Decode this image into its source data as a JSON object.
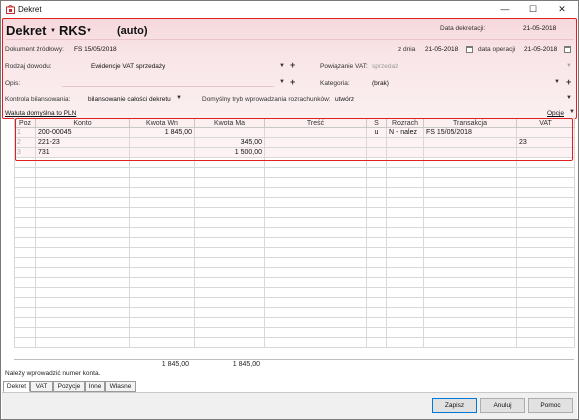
{
  "window": {
    "title": "Dekret",
    "minimize": "—",
    "maximize": "☐",
    "close": "✕"
  },
  "header": {
    "doc_type": "Dekret",
    "register": "RKS",
    "number": "(auto)",
    "date_label": "Data dekretacji:",
    "date_value": "21-05-2018",
    "source_doc_label": "Dokument źródłowy:",
    "source_doc_value": "FS 15/05/2018",
    "z_dnia_label": "z dnia",
    "z_dnia_value": "21-05-2018",
    "operation_date_label": "data operacji",
    "operation_date_value": "21-05-2018",
    "proof_type_label": "Rodzaj dowodu:",
    "proof_type_value": "Ewidencje VAT sprzedaży",
    "vat_link_label": "Powiązanie VAT:",
    "vat_link_value": "sprzedaż",
    "description_label": "Opis:",
    "category_label": "Kategoria:",
    "category_value": "(brak)",
    "balance_control_label": "Kontrola bilansowania:",
    "balance_control_value": "bilansowanie całości dekretu",
    "default_mode_label": "Domyślny tryb wprowadzania rozrachunków:",
    "default_mode_value": "utwórz",
    "currency_link": "Waluta domyślna to PLN",
    "options_label": "Opcje"
  },
  "grid": {
    "columns": [
      "Poz",
      "Konto",
      "Kwota Wn",
      "Kwota Ma",
      "Treść",
      "S",
      "Rozrach",
      "Transakcja",
      "VAT"
    ],
    "rows": [
      {
        "poz": "1",
        "konto": "200-00045",
        "wn": "1 845,00",
        "ma": "",
        "tresc": "",
        "s": "u",
        "rozrach": "N - nalez",
        "transakcja": "FS 15/05/2018",
        "vat": ""
      },
      {
        "poz": "2",
        "konto": "221-23",
        "wn": "",
        "ma": "345,00",
        "tresc": "",
        "s": "",
        "rozrach": "",
        "transakcja": "",
        "vat": "23"
      },
      {
        "poz": "3",
        "konto": "731",
        "wn": "",
        "ma": "1 500,00",
        "tresc": "",
        "s": "",
        "rozrach": "",
        "transakcja": "",
        "vat": ""
      }
    ],
    "total_wn": "1 845,00",
    "total_ma": "1 845,00"
  },
  "status_text": "Należy wprowadzić numer konta.",
  "tabs": [
    "Dekret",
    "VAT",
    "Pozycje",
    "Inne",
    "Własne"
  ],
  "buttons": {
    "save": "Zapisz",
    "cancel": "Anuluj",
    "help": "Pomoc"
  },
  "colors": {
    "highlight_frame": "#e02020",
    "header_tint": "#f6d8dc"
  }
}
